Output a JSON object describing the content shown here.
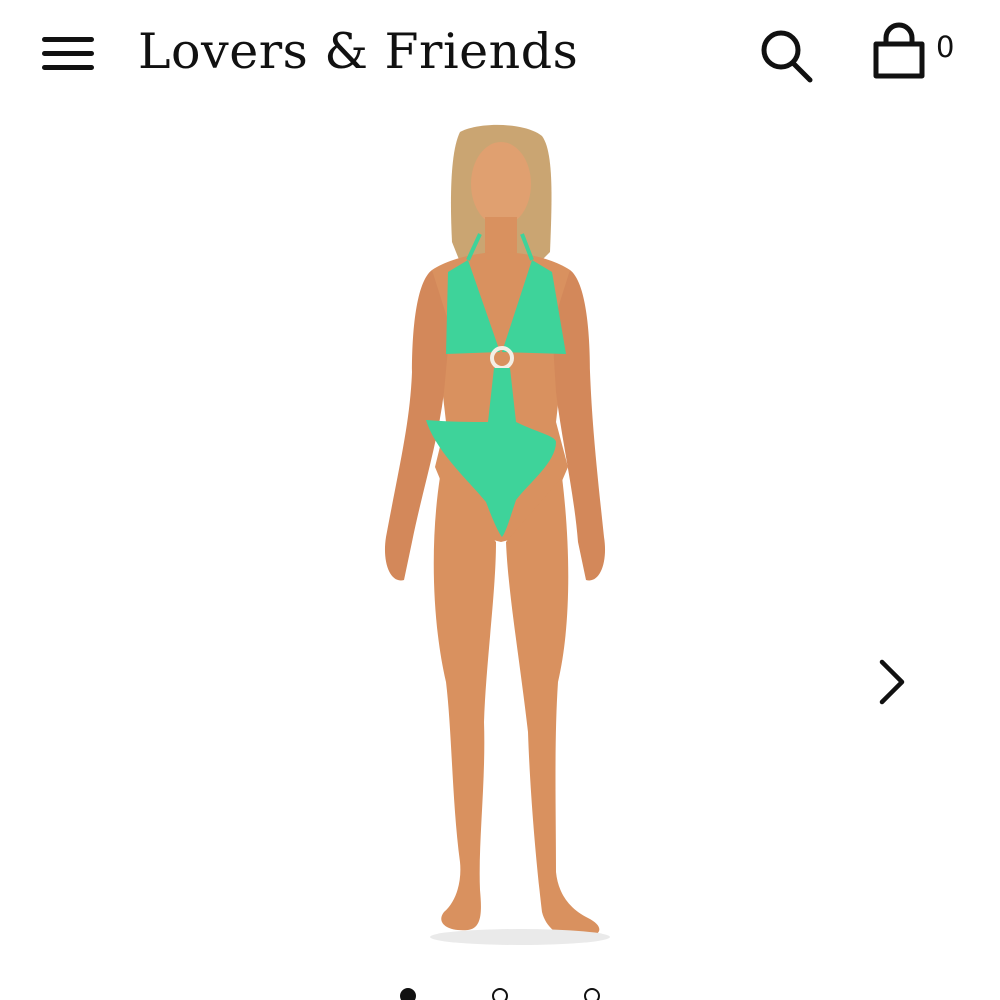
{
  "header": {
    "menu_icon": "hamburger-menu-icon",
    "brand": "Lovers & Friends",
    "search_icon": "search-icon",
    "bag_icon": "shopping-bag-icon",
    "bag_count": "0"
  },
  "product": {
    "image": "model wearing green textured cut-out one-piece swimsuit with ring detail",
    "swimsuit_color": "#3ed39a",
    "skin_color": "#d9915f",
    "hair_color": "#caa572"
  },
  "carousel": {
    "next_icon": "chevron-right-icon",
    "total_slides": 3,
    "active_slide": 1
  }
}
